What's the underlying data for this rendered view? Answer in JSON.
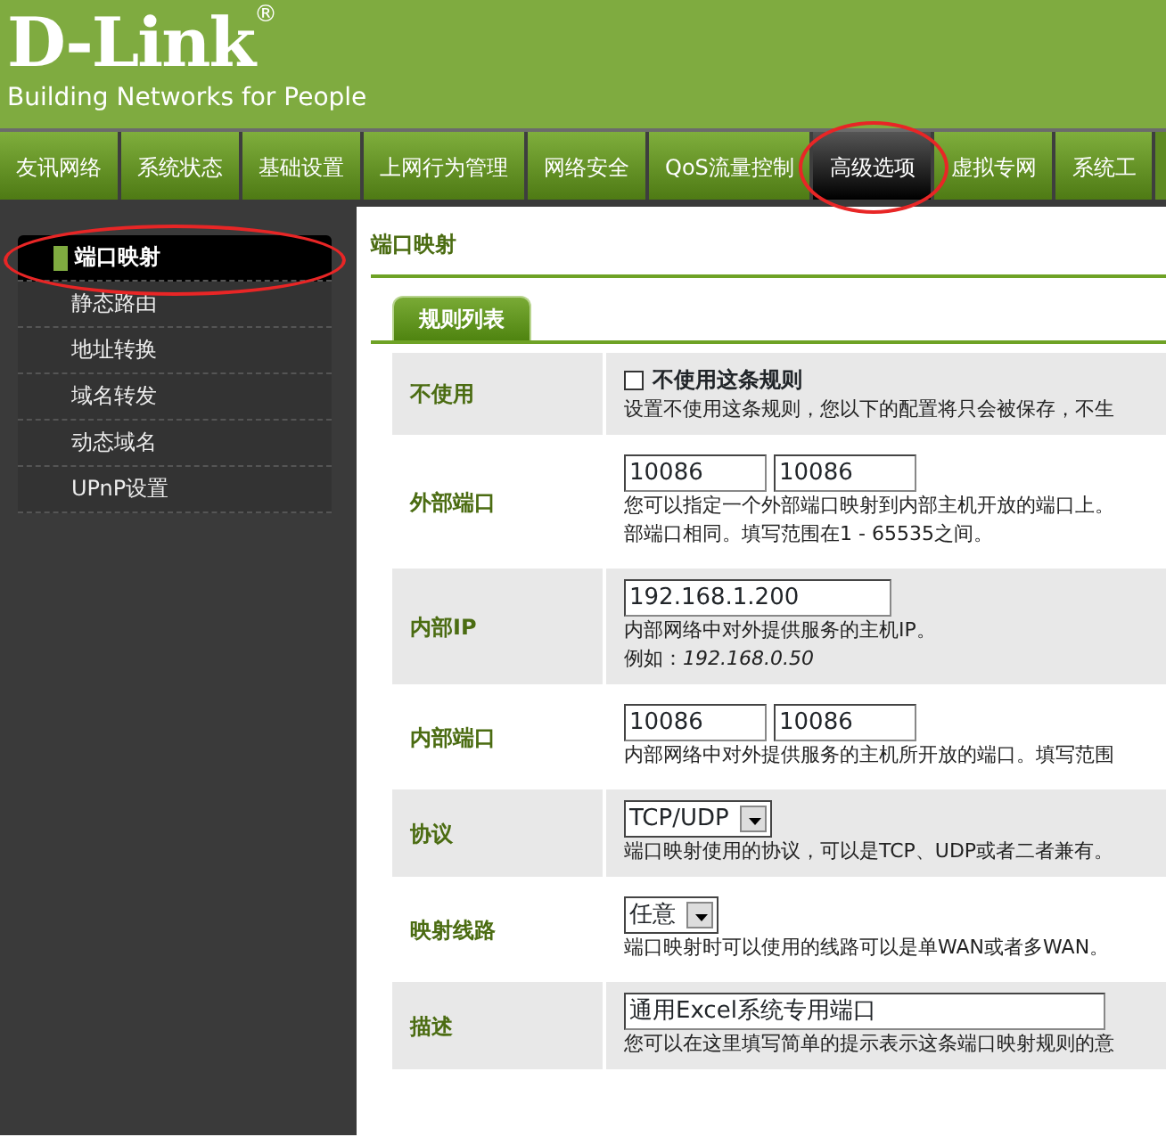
{
  "logo": {
    "brand": "D-Link",
    "mark": "®",
    "tagline": "Building Networks for People"
  },
  "nav": [
    {
      "label": "友讯网络",
      "selected": false,
      "highlighted": false
    },
    {
      "label": "系统状态",
      "selected": false,
      "highlighted": false
    },
    {
      "label": "基础设置",
      "selected": false,
      "highlighted": false
    },
    {
      "label": "上网行为管理",
      "selected": false,
      "highlighted": false
    },
    {
      "label": "网络安全",
      "selected": false,
      "highlighted": false
    },
    {
      "label": "QoS流量控制",
      "selected": false,
      "highlighted": false
    },
    {
      "label": "高级选项",
      "selected": true,
      "highlighted": true
    },
    {
      "label": "虚拟专网",
      "selected": false,
      "highlighted": false
    },
    {
      "label": "系统工",
      "selected": false,
      "highlighted": false
    }
  ],
  "sidebar": [
    {
      "label": "端口映射",
      "selected": true,
      "highlighted": true
    },
    {
      "label": "静态路由",
      "selected": false,
      "highlighted": false
    },
    {
      "label": "地址转换",
      "selected": false,
      "highlighted": false
    },
    {
      "label": "域名转发",
      "selected": false,
      "highlighted": false
    },
    {
      "label": "动态域名",
      "selected": false,
      "highlighted": false
    },
    {
      "label": "UPnP设置",
      "selected": false,
      "highlighted": false
    }
  ],
  "page_title": "端口映射",
  "tabs": [
    {
      "label": "规则列表",
      "selected": true
    }
  ],
  "rows": [
    {
      "kind": "checkbox",
      "label": "不使用",
      "checkbox_label": "不使用这条规则",
      "checked": false,
      "hint_lines": [
        "设置不使用这条规则，您以下的配置将只会被保存，不生"
      ]
    },
    {
      "kind": "range",
      "label": "外部端口",
      "values": [
        "10086",
        "10086"
      ],
      "hint_lines": [
        "您可以指定一个外部端口映射到内部主机开放的端口上。",
        "部端口相同。填写范围在1 - 65535之间。"
      ]
    },
    {
      "kind": "text",
      "label": "内部IP",
      "value": "192.168.1.200",
      "hint_lines": [
        "内部网络中对外提供服务的主机IP。",
        "例如：*192.168.0.50*"
      ]
    },
    {
      "kind": "range",
      "label": "内部端口",
      "values": [
        "10086",
        "10086"
      ],
      "hint_lines": [
        "内部网络中对外提供服务的主机所开放的端口。填写范围"
      ]
    },
    {
      "kind": "select",
      "label": "协议",
      "value": "TCP/UDP",
      "hint_lines": [
        "端口映射使用的协议，可以是TCP、UDP或者二者兼有。"
      ]
    },
    {
      "kind": "select",
      "label": "映射线路",
      "value": "任意",
      "hint_lines": [
        "端口映射时可以使用的线路可以是单WAN或者多WAN。"
      ]
    },
    {
      "kind": "text",
      "label": "描述",
      "value": "通用Excel系统专用端口",
      "wide": true,
      "hint_lines": [
        "您可以在这里填写简单的提示表示这条端口映射规则的意"
      ]
    }
  ]
}
